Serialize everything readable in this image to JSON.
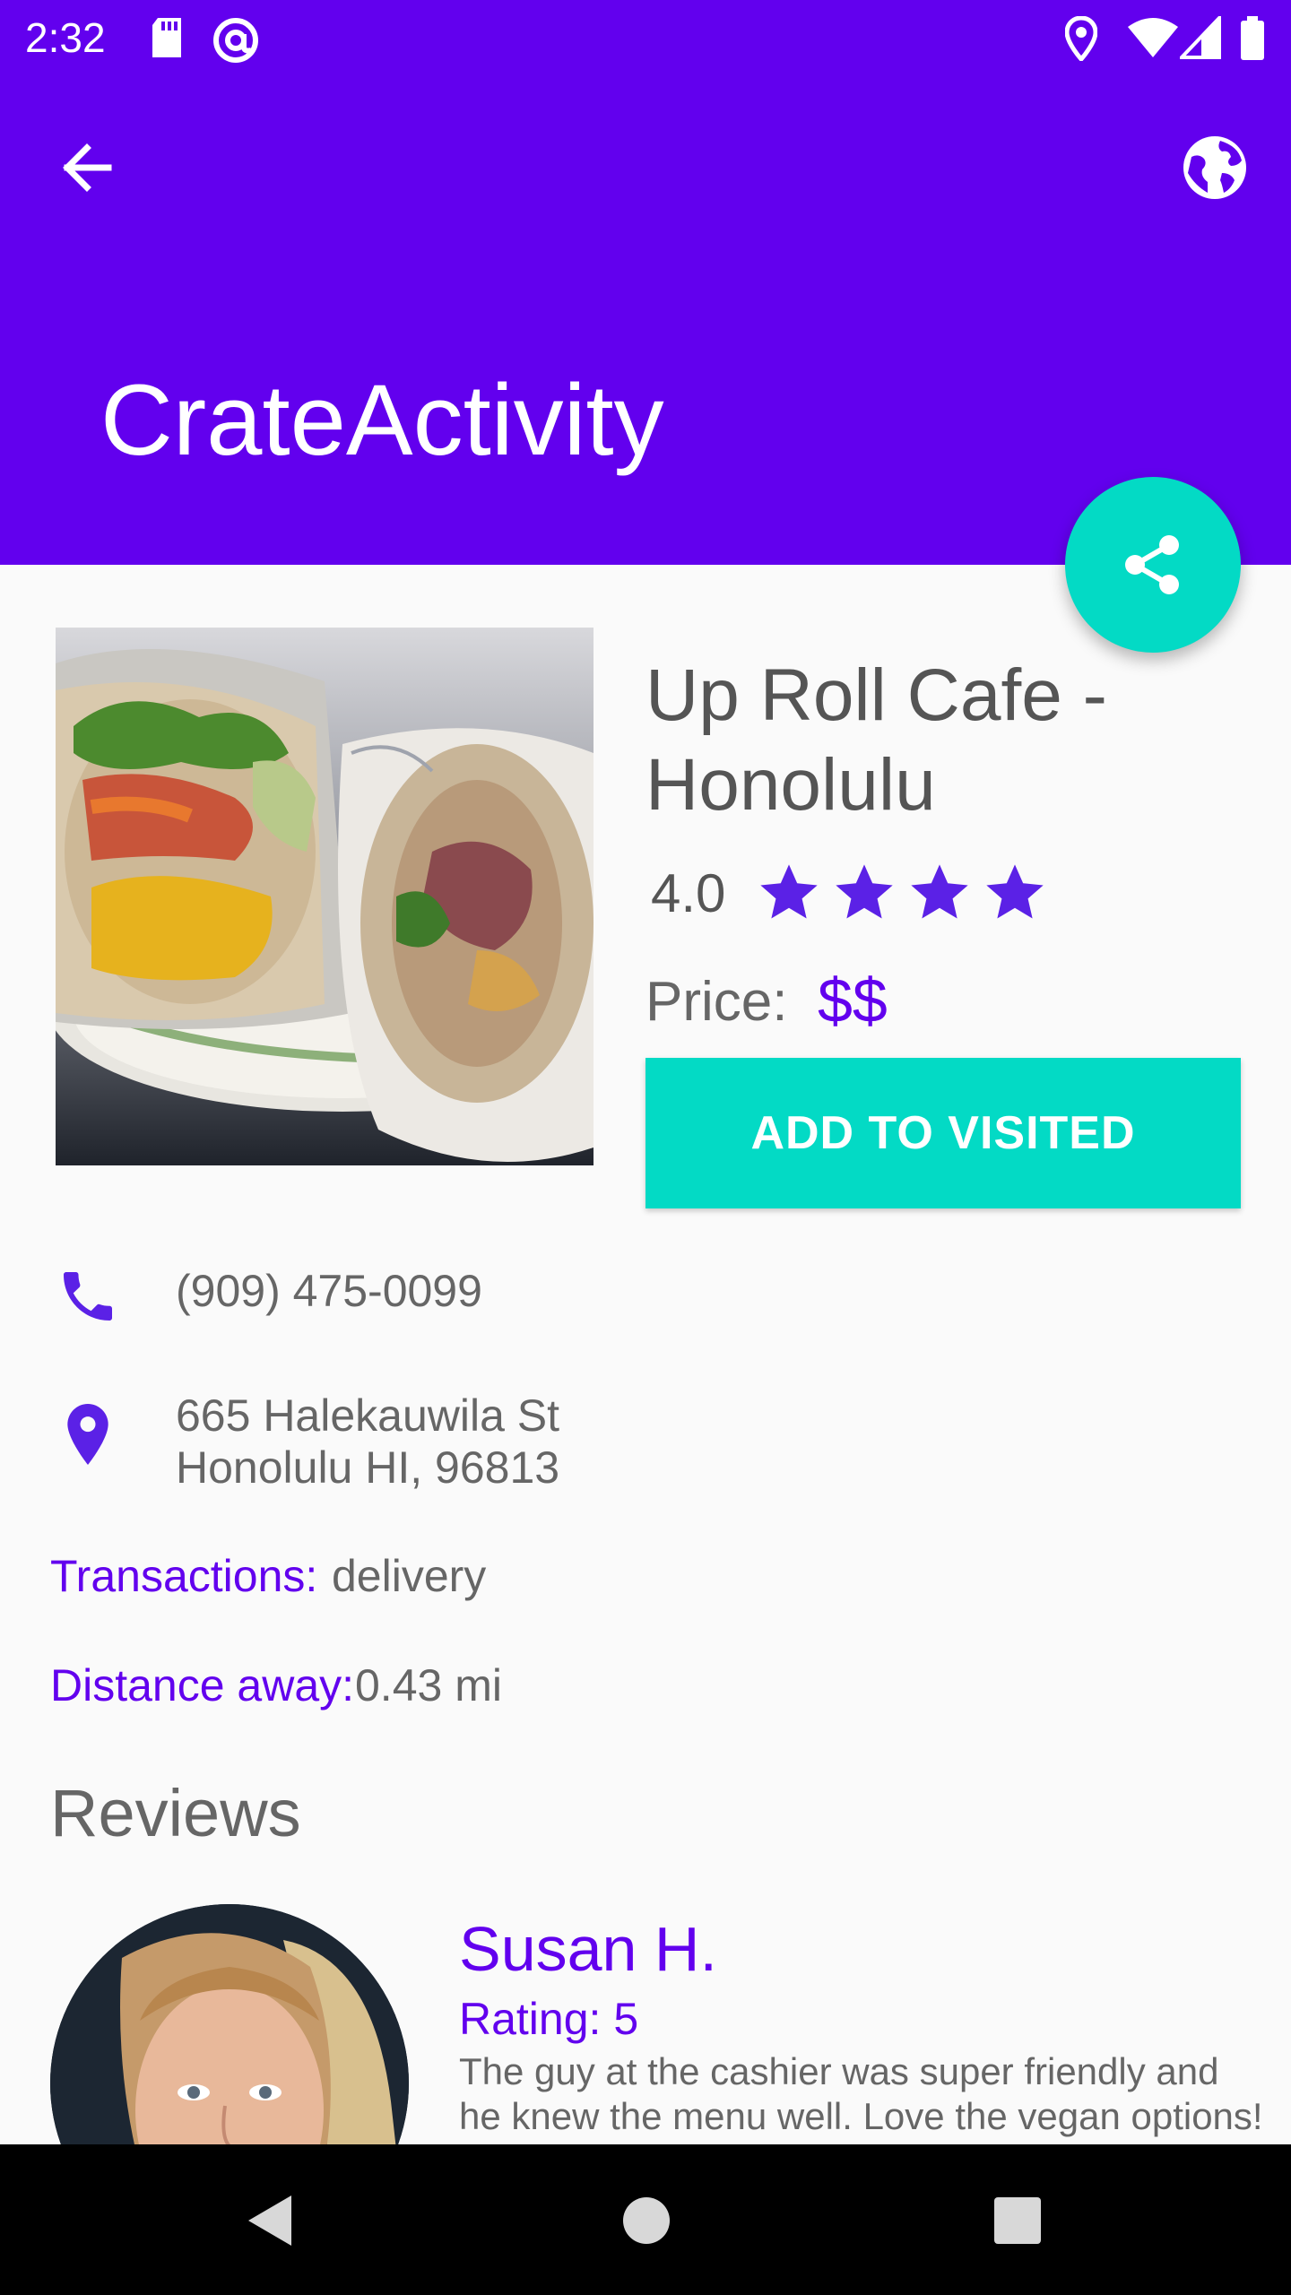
{
  "status_bar": {
    "time": "2:32"
  },
  "app_bar": {
    "title": "CrateActivity"
  },
  "business": {
    "name": "Up Roll Cafe - Honolulu",
    "rating": "4.0",
    "rating_value": 4,
    "price_label": "Price:",
    "price": "$$",
    "add_button_label": "ADD TO VISITED",
    "phone": "(909) 475-0099",
    "address_line1": "665 Halekauwila St",
    "address_line2": "Honolulu HI, 96813",
    "transactions_label": "Transactions:",
    "transactions_value": "delivery",
    "distance_label": "Distance away:",
    "distance_value": "0.43 mi"
  },
  "reviews": {
    "heading": "Reviews",
    "items": [
      {
        "name": "Susan H.",
        "rating": "Rating: 5",
        "text": "The guy at the cashier was super friendly and he knew the menu well.  Love the vegan options!"
      }
    ]
  },
  "colors": {
    "primary": "#6200ee",
    "accent": "#03dac5",
    "text_grey": "#666666"
  },
  "icons": {
    "back": "arrow-back-icon",
    "web": "globe-icon",
    "share": "share-icon",
    "phone": "phone-icon",
    "location": "location-pin-icon",
    "rating_star": "star-icon"
  }
}
